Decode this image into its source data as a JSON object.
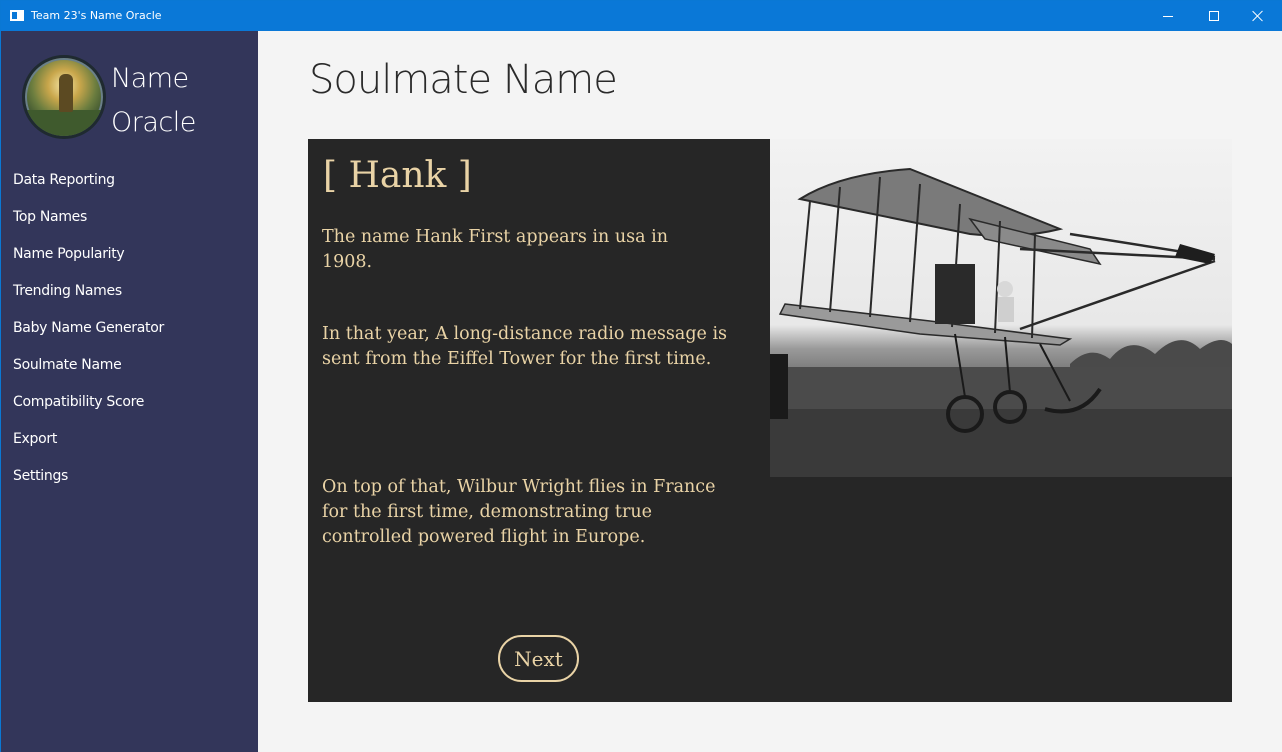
{
  "window": {
    "title": "Team 23's Name Oracle"
  },
  "sidebar": {
    "logo_title": "Name Oracle",
    "items": [
      {
        "label": "Data Reporting"
      },
      {
        "label": "Top Names"
      },
      {
        "label": "Name Popularity"
      },
      {
        "label": "Trending Names"
      },
      {
        "label": "Baby Name Generator"
      },
      {
        "label": "Soulmate Name"
      },
      {
        "label": "Compatibility Score"
      },
      {
        "label": "Export"
      },
      {
        "label": "Settings"
      }
    ]
  },
  "main": {
    "page_title": "Soulmate Name",
    "card": {
      "name_heading": "[ Hank ]",
      "paragraph_1": "The name Hank First appears in usa in 1908.",
      "paragraph_2": "In that year, A long-distance radio message is sent from the Eiffel Tower for the first time.",
      "paragraph_3": "On top of that, Wilbur Wright flies in France for the first time, demonstrating true controlled powered flight in Europe.",
      "next_label": "Next"
    }
  },
  "colors": {
    "titlebar": "#0a78d7",
    "sidebar": "#33365a",
    "card": "#262626",
    "accent_text": "#e9d3a6"
  },
  "icons": {
    "app": "window-icon",
    "minimize": "minimize-icon",
    "maximize": "maximize-icon",
    "close": "close-icon"
  }
}
